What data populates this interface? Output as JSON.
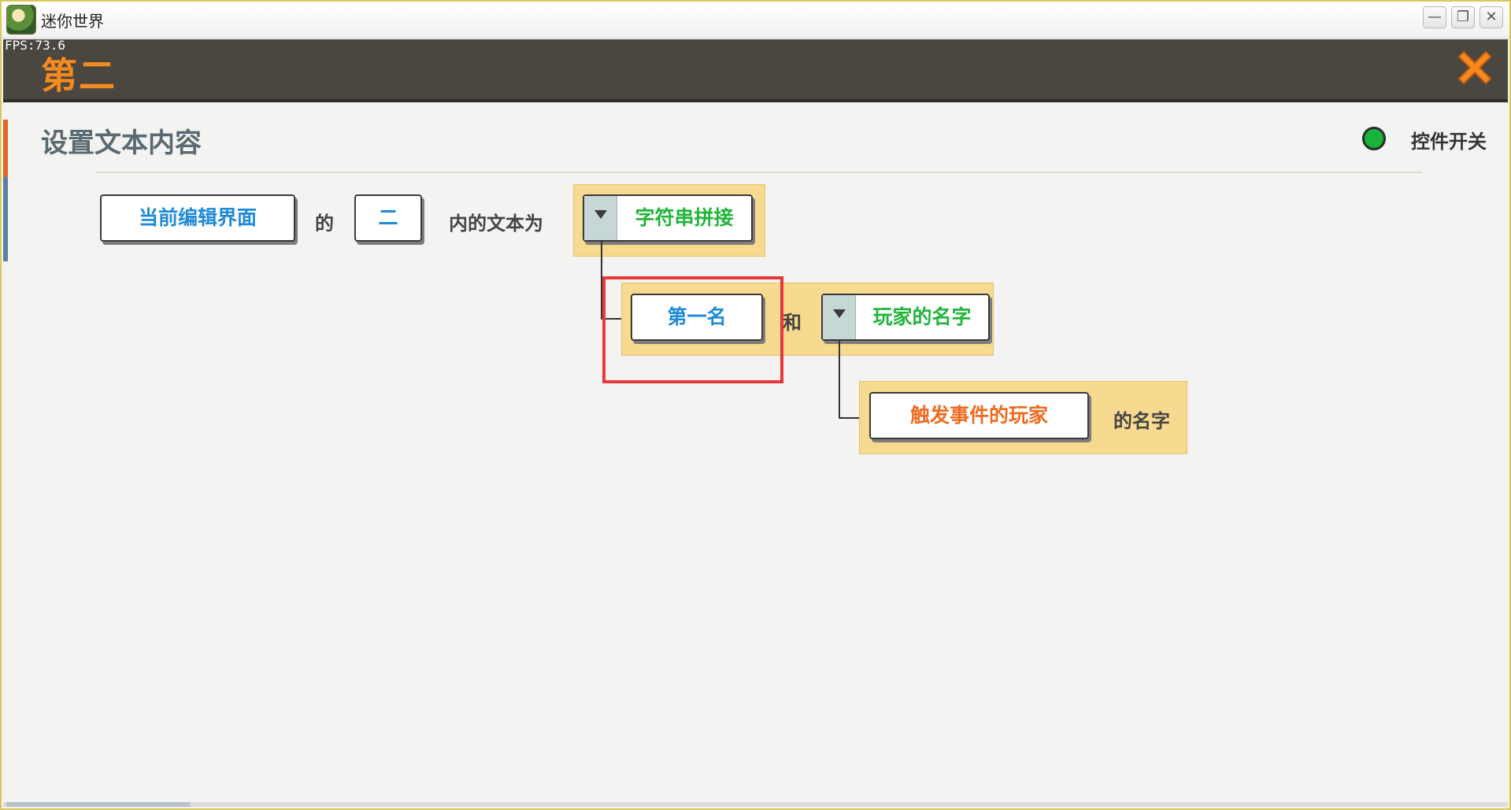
{
  "window": {
    "app_title": "迷你世界",
    "minimize_symbol": "—",
    "restore_symbol": "❐",
    "close_symbol": "✕",
    "fps": "FPS:73.6"
  },
  "header": {
    "title": "第二",
    "close_icon": "close-icon",
    "close_color": "#f58a1e"
  },
  "section": {
    "title": "设置文本内容",
    "toggle_label": "控件开关",
    "toggle_color": "#19b23a"
  },
  "row1": {
    "target_button": "当前编辑界面",
    "text_of": "的",
    "element_button": "二",
    "text_content_is": "内的文本为",
    "function_dropdown": "字符串拼接"
  },
  "row2": {
    "string_button": "第一名",
    "text_and": "和",
    "player_dropdown": "玩家的名字"
  },
  "row3": {
    "trigger_player_button": "触发事件的玩家",
    "text_name": "的名字"
  },
  "colors": {
    "accent_orange": "#ef6b20",
    "link_blue": "#1f8ad6",
    "value_green": "#22b53c",
    "panel_yellow": "#f7d98f",
    "highlight_red": "#e8383d"
  }
}
